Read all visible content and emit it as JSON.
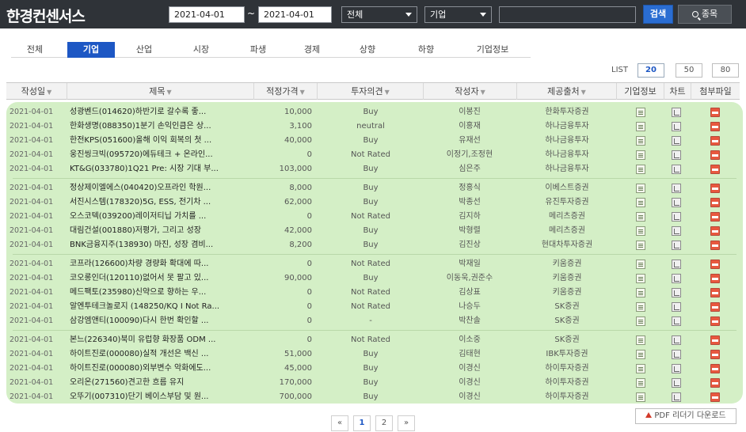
{
  "header": {
    "brand": "한경컨센서스",
    "date_from": "2021-04-01",
    "date_sep": "~",
    "date_to": "2021-04-01",
    "filter1": "전체",
    "filter2": "기업",
    "search_query": "",
    "search_btn": "검색",
    "list_btn": "종목"
  },
  "tabs": [
    {
      "label": "전체"
    },
    {
      "label": "기업"
    },
    {
      "label": "산업"
    },
    {
      "label": "시장"
    },
    {
      "label": "파생"
    },
    {
      "label": "경제"
    },
    {
      "label": "상향"
    },
    {
      "label": "하향"
    },
    {
      "label": "기업정보"
    }
  ],
  "active_tab": "기업",
  "list": {
    "label": "LIST",
    "options": [
      "20",
      "50",
      "80"
    ],
    "selected": "20"
  },
  "columns": {
    "date": "작성일",
    "title": "제목",
    "price": "적정가격",
    "opinion": "투자의견",
    "author": "작성자",
    "provider": "제공출처",
    "info": "기업정보",
    "chart": "차트",
    "file": "첨부파일"
  },
  "rows": [
    {
      "date": "2021-04-01",
      "title": "성광벤드(014620)하반기로 갈수록 좋...",
      "price": "10,000",
      "opinion": "Buy",
      "author": "이봉진",
      "provider": "한화투자증권"
    },
    {
      "date": "2021-04-01",
      "title": "한화생명(088350)1분기 손익인큼은 상...",
      "price": "3,100",
      "opinion": "neutral",
      "author": "이홍재",
      "provider": "하나금융투자"
    },
    {
      "date": "2021-04-01",
      "title": "한전KPS(051600)올해 이익 회복의 첫 ...",
      "price": "40,000",
      "opinion": "Buy",
      "author": "유재선",
      "provider": "하나금융투자"
    },
    {
      "date": "2021-04-01",
      "title": "웅진씽크빅(095720)에듀테크 + 온라인...",
      "price": "0",
      "opinion": "Not Rated",
      "author": "이정기,조정현",
      "provider": "하나금융투자"
    },
    {
      "date": "2021-04-01",
      "title": "KT&G(033780)1Q21 Pre: 시장 기대 부...",
      "price": "103,000",
      "opinion": "Buy",
      "author": "심은주",
      "provider": "하나금융투자"
    },
    {
      "date": "2021-04-01",
      "title": "정상제이엘에스(040420)오프라인 학원...",
      "price": "8,000",
      "opinion": "Buy",
      "author": "정홍식",
      "provider": "이베스트증권"
    },
    {
      "date": "2021-04-01",
      "title": "서진시스템(178320)5G, ESS, 전기차 ...",
      "price": "62,000",
      "opinion": "Buy",
      "author": "박종선",
      "provider": "유진투자증권"
    },
    {
      "date": "2021-04-01",
      "title": "오스코텍(039200)레이저티닙 가치를 ...",
      "price": "0",
      "opinion": "Not Rated",
      "author": "김지하",
      "provider": "메리츠증권"
    },
    {
      "date": "2021-04-01",
      "title": "대림건설(001880)저평가, 그리고 성장",
      "price": "42,000",
      "opinion": "Buy",
      "author": "박형렬",
      "provider": "메리츠증권"
    },
    {
      "date": "2021-04-01",
      "title": "BNK금융지주(138930) 마진, 성장 겸비...",
      "price": "8,200",
      "opinion": "Buy",
      "author": "김진상",
      "provider": "현대차투자증권"
    },
    {
      "date": "2021-04-01",
      "title": "코프라(126600)차량 경량화 확대에 따...",
      "price": "0",
      "opinion": "Not Rated",
      "author": "박재일",
      "provider": "키움증권"
    },
    {
      "date": "2021-04-01",
      "title": "코오롱인더(120110)없어서 못 팔고 있...",
      "price": "90,000",
      "opinion": "Buy",
      "author": "이동욱,권준수",
      "provider": "키움증권"
    },
    {
      "date": "2021-04-01",
      "title": "메드팩토(235980)신약으로 향하는 우...",
      "price": "0",
      "opinion": "Not Rated",
      "author": "김상표",
      "provider": "키움증권"
    },
    {
      "date": "2021-04-01",
      "title": "알엔투테크놀로지 (148250/KQ I Not Ra...",
      "price": "0",
      "opinion": "Not Rated",
      "author": "나승두",
      "provider": "SK증권"
    },
    {
      "date": "2021-04-01",
      "title": "삼강엠앤티(100090)다시 한번 확인할 ...",
      "price": "0",
      "opinion": "-",
      "author": "박찬솔",
      "provider": "SK증권"
    },
    {
      "date": "2021-04-01",
      "title": "본느(226340)북미 유럽향 화장품 ODM ...",
      "price": "0",
      "opinion": "Not Rated",
      "author": "이소중",
      "provider": "SK증권"
    },
    {
      "date": "2021-04-01",
      "title": "하이트진로(000080)실적 개선은 백신 ...",
      "price": "51,000",
      "opinion": "Buy",
      "author": "김태현",
      "provider": "IBK투자증권"
    },
    {
      "date": "2021-04-01",
      "title": "하이트진로(000080)외부변수 악화에도...",
      "price": "45,000",
      "opinion": "Buy",
      "author": "이경신",
      "provider": "하이투자증권"
    },
    {
      "date": "2021-04-01",
      "title": "오리온(271560)견고한 흐름 유지",
      "price": "170,000",
      "opinion": "Buy",
      "author": "이경신",
      "provider": "하이투자증권"
    },
    {
      "date": "2021-04-01",
      "title": "오뚜기(007310)단기 베이스부담 및 원...",
      "price": "700,000",
      "opinion": "Buy",
      "author": "이경신",
      "provider": "하이투자증권"
    }
  ],
  "pagination": {
    "first": "«",
    "pages": [
      "1",
      "2"
    ],
    "current": "1",
    "last": "»"
  },
  "pdf_download": "PDF 리더기 다운로드",
  "icons": {
    "info": "document-icon",
    "chart": "chart-icon",
    "file": "pdf-icon"
  },
  "colors": {
    "header_bg": "#2f3338",
    "accent": "#1d57c4",
    "search_btn": "#2a6dd2",
    "table_bg": "#d4efc6"
  }
}
